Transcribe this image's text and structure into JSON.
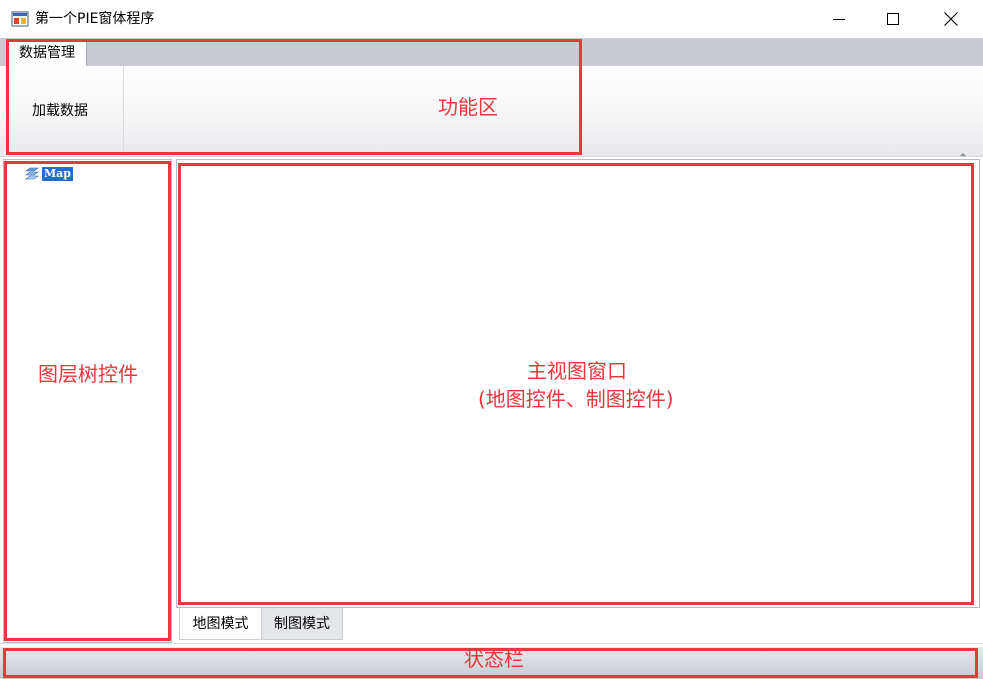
{
  "window": {
    "title": "第一个PIE窗体程序",
    "minimize_icon": "minimize-icon",
    "maximize_icon": "maximize-icon",
    "close_icon": "close-icon"
  },
  "ribbon": {
    "tabs": [
      {
        "label": "数据管理",
        "selected": true
      }
    ],
    "buttons": [
      {
        "label": "加载数据"
      }
    ]
  },
  "layer_tree": {
    "nodes": [
      {
        "label": "Map",
        "icon": "layers-icon",
        "selected": true
      }
    ]
  },
  "view_tabs": [
    {
      "label": "地图模式",
      "selected": true
    },
    {
      "label": "制图模式",
      "selected": false
    }
  ],
  "annotations": {
    "ribbon_label": "功能区",
    "layer_tree_label": "图层树控件",
    "main_view_label_line1": "主视图窗口",
    "main_view_label_line2": "(地图控件、制图控件)",
    "statusbar_label": "状态栏"
  },
  "colors": {
    "annotation": "#e8383d",
    "selection": "#1f6fd0",
    "ribbon_tabstrip": "#c8cbd2"
  }
}
